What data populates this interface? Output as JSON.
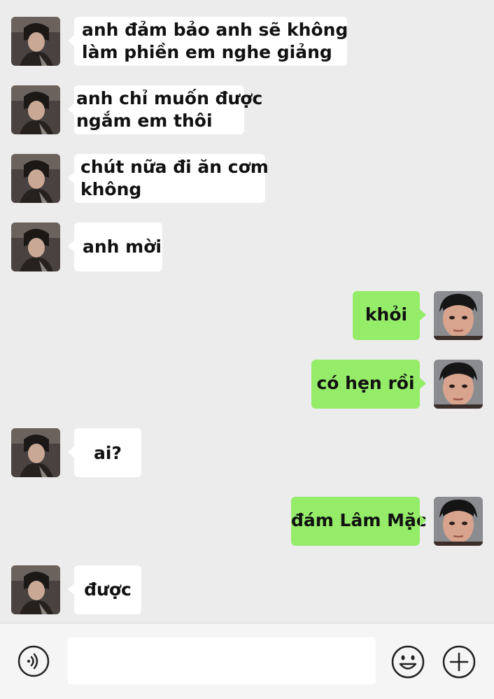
{
  "messages": [
    {
      "side": "left",
      "lines": [
        "anh đảm bảo anh sẽ không",
        "làm phiền em nghe giảng"
      ]
    },
    {
      "side": "left",
      "lines": [
        "anh chỉ muốn được",
        "ngắm em thôi"
      ]
    },
    {
      "side": "left",
      "lines": [
        "chút nữa đi ăn cơm",
        "không"
      ]
    },
    {
      "side": "left",
      "lines": [
        "anh mời"
      ]
    },
    {
      "side": "right",
      "lines": [
        "khỏi"
      ]
    },
    {
      "side": "right",
      "lines": [
        "có hẹn rồi"
      ]
    },
    {
      "side": "left",
      "lines": [
        "ai?"
      ]
    },
    {
      "side": "right",
      "lines": [
        "đám Lâm Mặc"
      ]
    },
    {
      "side": "left",
      "lines": [
        "được"
      ]
    }
  ],
  "input": {
    "value": "",
    "placeholder": ""
  },
  "icons": {
    "voice": "voice-input-icon",
    "emoji": "emoji-icon",
    "add": "plus-icon"
  },
  "colors": {
    "background": "#ececec",
    "incoming_bubble": "#ffffff",
    "outgoing_bubble": "#95ec69",
    "input_bar": "#f5f5f5"
  }
}
